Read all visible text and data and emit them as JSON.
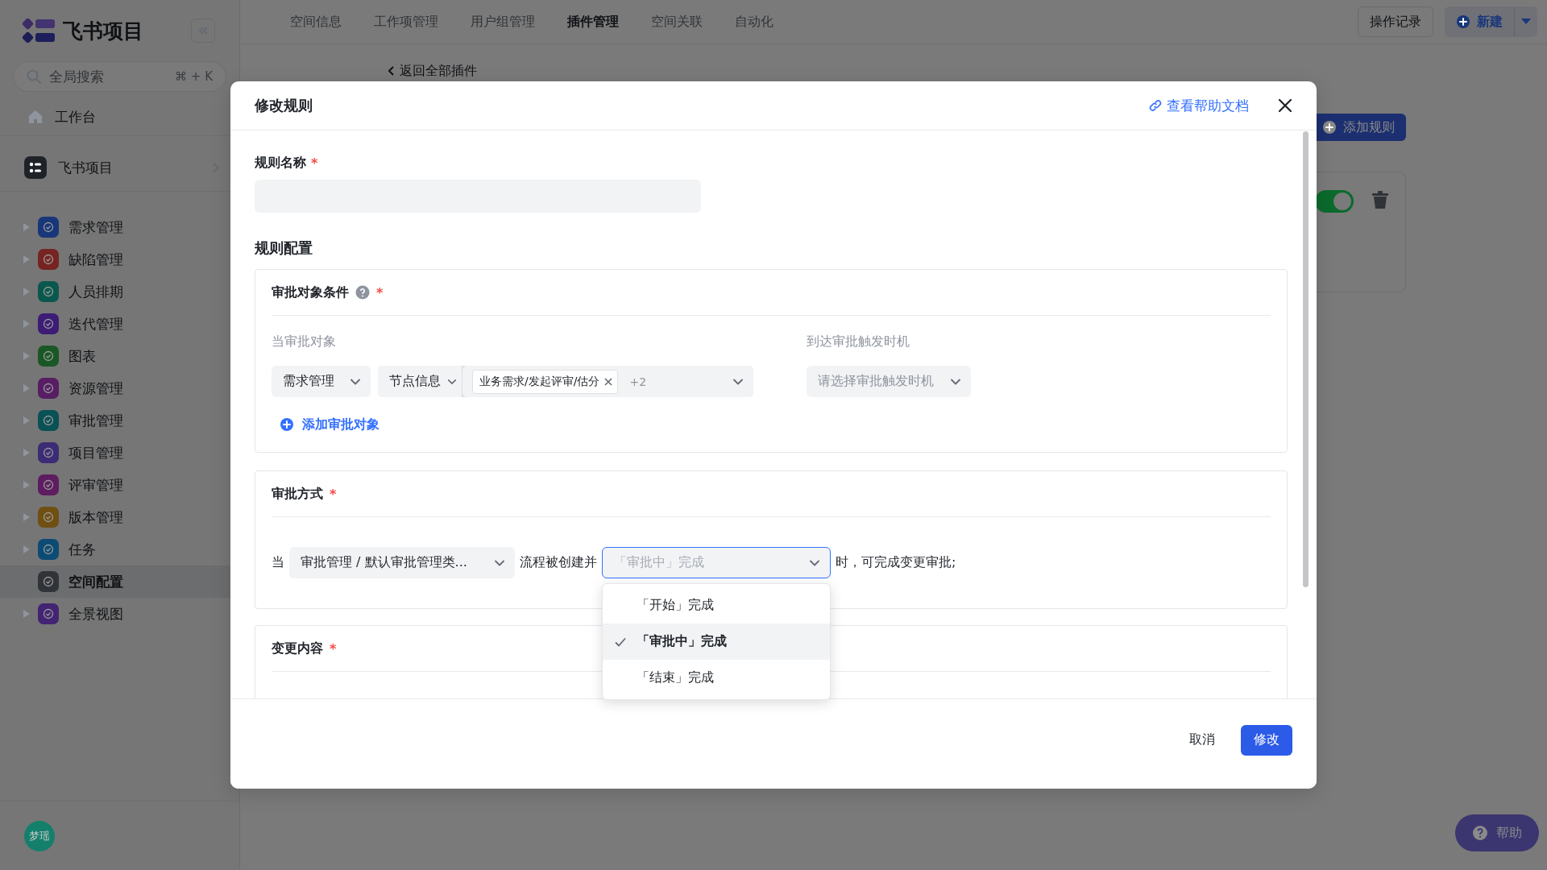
{
  "sidebar": {
    "logo": "飞书项目",
    "search": {
      "placeholder": "全局搜索",
      "shortcut": "⌘ + K"
    },
    "workbench": "工作台",
    "space": "飞书项目",
    "items": [
      {
        "label": "需求管理",
        "color": "#18367a",
        "expandable": true,
        "selected": false
      },
      {
        "label": "缺陷管理",
        "color": "#762421",
        "expandable": true,
        "selected": false
      },
      {
        "label": "人员排期",
        "color": "#0a584d",
        "expandable": true,
        "selected": false
      },
      {
        "label": "迭代管理",
        "color": "#3d1c76",
        "expandable": true,
        "selected": false
      },
      {
        "label": "图表",
        "color": "#195824",
        "expandable": true,
        "selected": false
      },
      {
        "label": "资源管理",
        "color": "#571e64",
        "expandable": true,
        "selected": false
      },
      {
        "label": "审批管理",
        "color": "#095154",
        "expandable": true,
        "selected": false
      },
      {
        "label": "项目管理",
        "color": "#3c2c76",
        "expandable": true,
        "selected": false
      },
      {
        "label": "评审管理",
        "color": "#5d1d60",
        "expandable": true,
        "selected": false
      },
      {
        "label": "版本管理",
        "color": "#6f5012",
        "expandable": true,
        "selected": false
      },
      {
        "label": "任务",
        "color": "#0c4b73",
        "expandable": true,
        "selected": false
      },
      {
        "label": "空间配置",
        "color": "#303337",
        "expandable": false,
        "selected": true
      },
      {
        "label": "全景视图",
        "color": "#422473",
        "expandable": true,
        "selected": false
      }
    ],
    "user": "梦瑶"
  },
  "top_nav": {
    "tabs": [
      {
        "label": "空间信息",
        "selected": false
      },
      {
        "label": "工作项管理",
        "selected": false
      },
      {
        "label": "用户组管理",
        "selected": false
      },
      {
        "label": "插件管理",
        "selected": true
      },
      {
        "label": "空间关联",
        "selected": false
      },
      {
        "label": "自动化",
        "selected": false
      }
    ],
    "history_button": "操作记录",
    "new_button": "新建"
  },
  "content": {
    "back_link": "返回全部插件",
    "add_rule_button": "添加规则",
    "rule_enabled": true,
    "help_button": "帮助"
  },
  "modal": {
    "title": "修改规则",
    "help_link": "查看帮助文档",
    "name_field": {
      "label": "规则名称",
      "required_mark": "*"
    },
    "section_title": "规则配置",
    "object_card": {
      "title": "审批对象条件",
      "required_mark": "*",
      "object_label": "当审批对象",
      "timing_label": "到达审批触发时机",
      "type_select": "需求管理",
      "field_select": "节点信息",
      "tag": "业务需求/发起评审/估分",
      "more_count": "+2",
      "timing_placeholder": "请选择审批触发时机",
      "add_link": "添加审批对象"
    },
    "method_card": {
      "title": "审批方式",
      "required_mark": "*",
      "prefix": "当",
      "flow_select": "审批管理 / 默认审批管理类...",
      "middle": "流程被创建并",
      "stage_select": "「审批中」完成",
      "open": true,
      "suffix": "时，可完成变更审批;",
      "options": [
        {
          "label": "「开始」完成",
          "selected": false
        },
        {
          "label": "「审批中」完成",
          "selected": true
        },
        {
          "label": "「结束」完成",
          "selected": false
        }
      ]
    },
    "change_card": {
      "title": "变更内容",
      "required_mark": "*"
    },
    "cancel_button": "取消",
    "submit_button": "修改"
  }
}
